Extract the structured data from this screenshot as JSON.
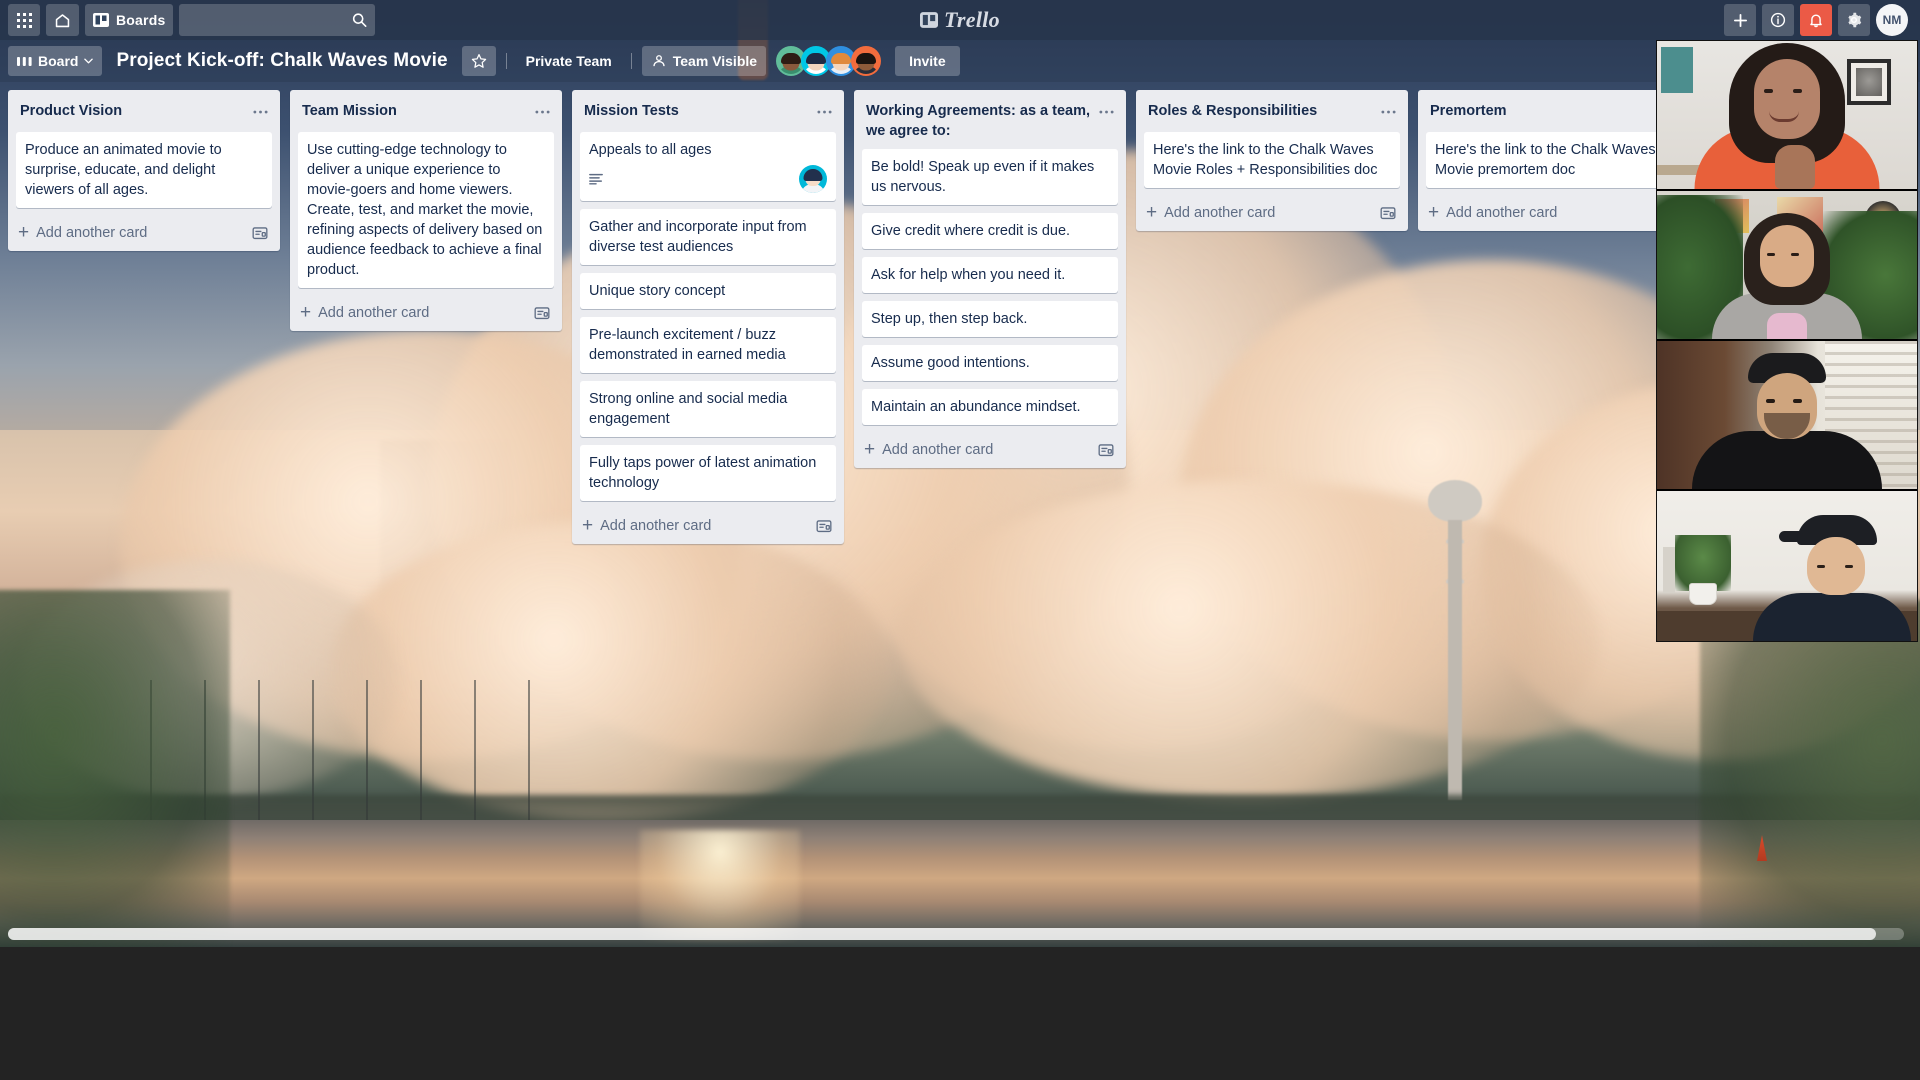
{
  "topnav": {
    "apps_icon": "grid-apps-icon",
    "home_icon": "home-icon",
    "boards_icon": "board-icon",
    "boards_label": "Boards",
    "search_value": "",
    "search_placeholder": "",
    "search_icon": "search-icon",
    "brand_name": "Trello",
    "brand_icon": "trello-logo-icon",
    "add_icon": "plus-icon",
    "info_icon": "info-circle-icon",
    "notifications_icon": "bell-icon",
    "notifications_active": true,
    "notifications_color": "#eb5a46",
    "settings_icon": "gear-icon",
    "user_initials": "NM"
  },
  "boardheader": {
    "board_button_label": "Board",
    "board_button_icon": "board-view-icon",
    "board_button_caret": "chevron-down-icon",
    "title": "Project Kick-off: Chalk Waves Movie",
    "star_icon": "star-icon",
    "team_label": "Private Team",
    "visibility_label": "Team Visible",
    "visibility_icon": "team-visible-icon",
    "invite_label": "Invite",
    "members": [
      {
        "name": "member-1",
        "bg": "#61bd9a",
        "hair": "#2e1d14",
        "skin": "#8a5a3c",
        "shirt": "#3a8f6e"
      },
      {
        "name": "member-2",
        "bg": "#00c7e6",
        "hair": "#1f2a44",
        "skin": "#f2d3bd",
        "shirt": "#ffffff"
      },
      {
        "name": "member-3",
        "bg": "#2f8fe0",
        "hair": "#e08a3c",
        "skin": "#f5d6bc",
        "shirt": "#e8eef5"
      },
      {
        "name": "member-4",
        "bg": "#f26c3d",
        "hair": "#1c1410",
        "skin": "#8f5b3a",
        "shirt": "#2a2f3a"
      }
    ]
  },
  "board": {
    "add_card_label": "Add another card",
    "add_card_plus": "+",
    "template_icon": "card-template-icon",
    "list_menu_icon": "list-menu-icon",
    "lists": [
      {
        "title": "Product Vision",
        "cards": [
          {
            "text": "Produce an animated movie to surprise, educate, and delight viewers of all ages.",
            "has_desc": false,
            "avatar": null
          }
        ]
      },
      {
        "title": "Team Mission",
        "cards": [
          {
            "text": "Use cutting-edge technology to deliver a unique experience to movie-goers and home viewers. Create, test, and market the movie, refining aspects of delivery based on audience feedback to achieve a final product.",
            "has_desc": false,
            "avatar": null
          }
        ]
      },
      {
        "title": "Mission Tests",
        "cards": [
          {
            "text": "Appeals to all ages",
            "has_desc": true,
            "avatar": "assignee-avatar"
          },
          {
            "text": "Gather and incorporate input from diverse test audiences",
            "has_desc": false,
            "avatar": null
          },
          {
            "text": "Unique story concept",
            "has_desc": false,
            "avatar": null
          },
          {
            "text": "Pre-launch excitement / buzz demonstrated in earned media",
            "has_desc": false,
            "avatar": null
          },
          {
            "text": "Strong online and social media engagement",
            "has_desc": false,
            "avatar": null
          },
          {
            "text": "Fully taps power of latest animation technology",
            "has_desc": false,
            "avatar": null
          }
        ]
      },
      {
        "title": "Working Agreements: as a team, we agree to:",
        "cards": [
          {
            "text": "Be bold! Speak up even if it makes us nervous.",
            "has_desc": false,
            "avatar": null
          },
          {
            "text": "Give credit where credit is due.",
            "has_desc": false,
            "avatar": null
          },
          {
            "text": "Ask for help when you need it.",
            "has_desc": false,
            "avatar": null
          },
          {
            "text": "Step up, then step back.",
            "has_desc": false,
            "avatar": null
          },
          {
            "text": "Assume good intentions.",
            "has_desc": false,
            "avatar": null
          },
          {
            "text": "Maintain an abundance mindset.",
            "has_desc": false,
            "avatar": null
          }
        ]
      },
      {
        "title": "Roles & Responsibilities",
        "cards": [
          {
            "text": "Here's the link to the Chalk Waves Movie Roles + Responsibilities doc",
            "has_desc": false,
            "avatar": null
          }
        ]
      },
      {
        "title": "Premortem",
        "cards": [
          {
            "text": "Here's the link to the Chalk Waves Movie premortem doc",
            "has_desc": false,
            "avatar": null
          }
        ]
      }
    ]
  },
  "video_panel": {
    "name": "video-call-participants",
    "tiles": [
      {
        "name": "video-tile-participant-1"
      },
      {
        "name": "video-tile-participant-2"
      },
      {
        "name": "video-tile-participant-3"
      },
      {
        "name": "video-tile-participant-4"
      }
    ]
  },
  "background": {
    "name": "board-background-photo-rocket-launch"
  }
}
